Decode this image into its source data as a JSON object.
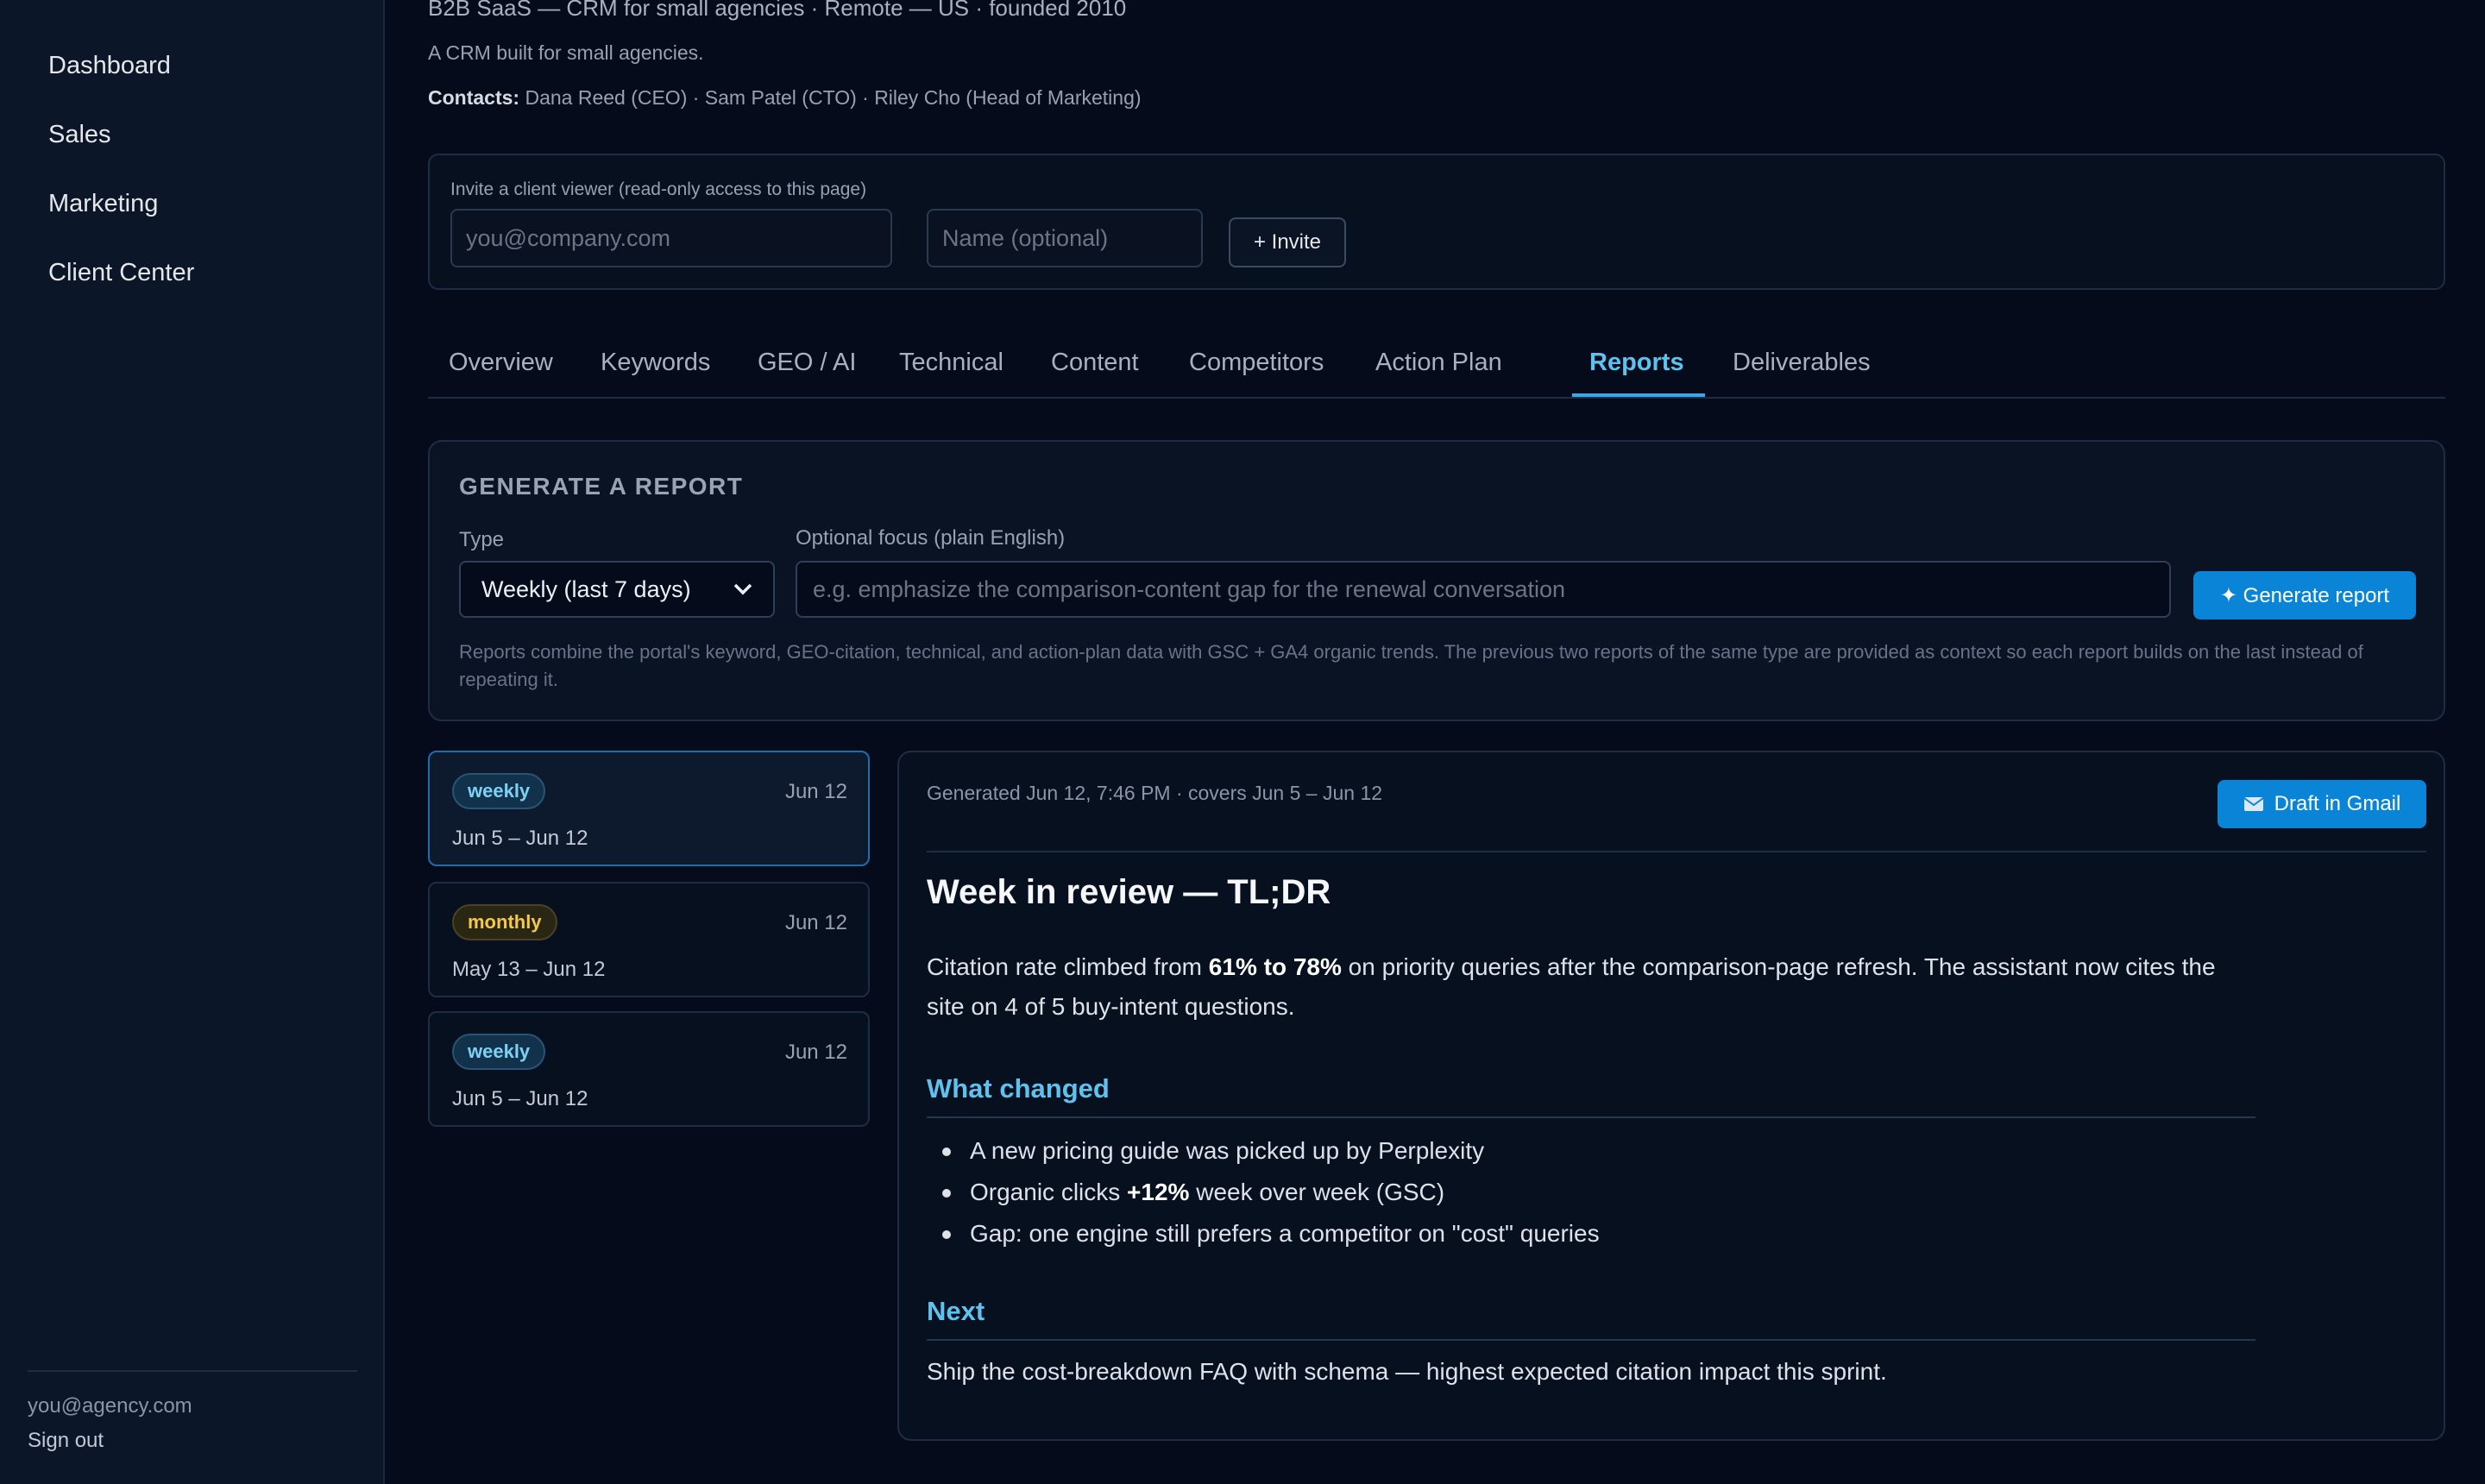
{
  "sidebar": {
    "items": [
      {
        "label": "Dashboard"
      },
      {
        "label": "Sales"
      },
      {
        "label": "Marketing"
      },
      {
        "label": "Client Center"
      }
    ],
    "user_email": "you@agency.com",
    "sign_out": "Sign out"
  },
  "client": {
    "summary_line": "B2B SaaS — CRM for small agencies · Remote — US · founded 2010",
    "description": "A CRM built for small agencies.",
    "contacts_label": "Contacts:",
    "contacts": "Dana Reed (CEO) · Sam Patel (CTO) · Riley Cho (Head of Marketing)"
  },
  "invite": {
    "label": "Invite a client viewer (read-only access to this page)",
    "email_placeholder": "you@company.com",
    "name_placeholder": "Name (optional)",
    "button": "+ Invite"
  },
  "tabs": [
    {
      "label": "Overview"
    },
    {
      "label": "Keywords"
    },
    {
      "label": "GEO / AI"
    },
    {
      "label": "Technical"
    },
    {
      "label": "Content"
    },
    {
      "label": "Competitors"
    },
    {
      "label": "Action Plan"
    },
    {
      "label": "Reports"
    },
    {
      "label": "Deliverables"
    }
  ],
  "active_tab": "Reports",
  "generate": {
    "title": "GENERATE A REPORT",
    "type_label": "Type",
    "type_value": "Weekly (last 7 days)",
    "focus_label": "Optional focus (plain English)",
    "focus_placeholder": "e.g. emphasize the comparison-content gap for the renewal conversation",
    "button": "✦ Generate report",
    "help": "Reports combine the portal's keyword, GEO-citation, technical, and action-plan data with GSC + GA4 organic trends. The previous two reports of the same type are provided as context so each report builds on the last instead of repeating it."
  },
  "reports": [
    {
      "type": "weekly",
      "date": "Jun 12",
      "range": "Jun 5 – Jun 12",
      "selected": true
    },
    {
      "type": "monthly",
      "date": "Jun 12",
      "range": "May 13 – Jun 12",
      "selected": false
    },
    {
      "type": "weekly",
      "date": "Jun 12",
      "range": "Jun 5 – Jun 12",
      "selected": false
    }
  ],
  "detail": {
    "meta": "Generated Jun 12, 7:46 PM · covers Jun 5 – Jun 12",
    "gmail_button": "Draft in Gmail",
    "title": "Week in review — TL;DR",
    "para_pre": "Citation rate climbed from ",
    "para_bold": "61% to 78%",
    "para_post": " on priority queries after the comparison-page refresh. The assistant now cites the site on 4 of 5 buy-intent questions.",
    "changed_heading": "What changed",
    "bullet1": "A new pricing guide was picked up by Perplexity",
    "bullet2_pre": "Organic clicks ",
    "bullet2_bold": "+12%",
    "bullet2_post": " week over week (GSC)",
    "bullet3": "Gap: one engine still prefers a competitor on \"cost\" queries",
    "next_heading": "Next",
    "next_text": "Ship the cost-breakdown FAQ with schema — highest expected citation impact this sprint."
  },
  "colors": {
    "accent": "#0a84d6",
    "tab_active": "#5ec2ee",
    "weekly_badge": "#7ed0f5",
    "monthly_badge": "#f2c94c"
  },
  "icons": {
    "select_caret": "chevron-down-icon",
    "gmail": "envelope-icon"
  }
}
